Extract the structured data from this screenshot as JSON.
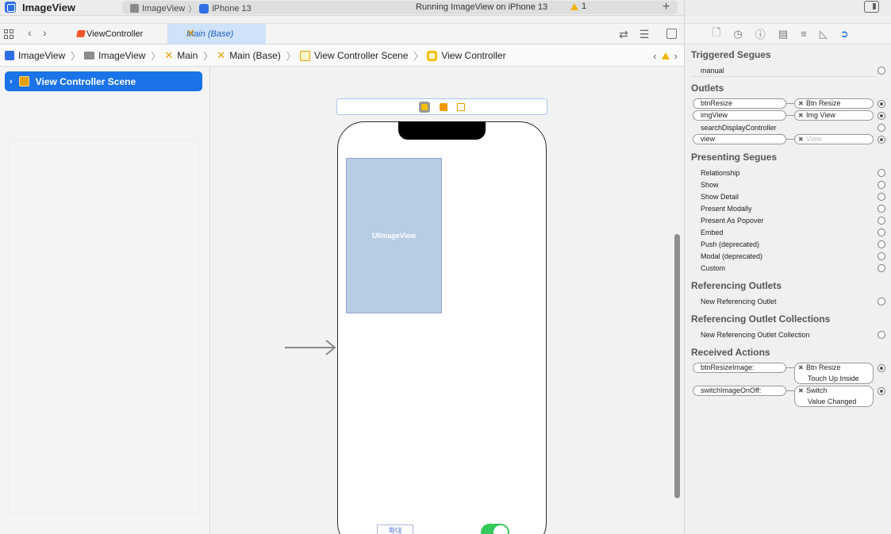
{
  "titlebar": {
    "app_title": "ImageView",
    "target": "ImageView",
    "device": "iPhone 13",
    "run_status": "Running ImageView on iPhone 13",
    "warning_count": "1",
    "add_label": "+"
  },
  "tabs": [
    {
      "label": "ViewController"
    },
    {
      "label": "Main (Base)"
    }
  ],
  "breadcrumb": [
    "ImageView",
    "ImageView",
    "Main",
    "Main (Base)",
    "View Controller Scene",
    "View Controller"
  ],
  "outline": {
    "scene_label": "View Controller Scene"
  },
  "canvas": {
    "image_view_label": "UIImageView",
    "button_label": "확대"
  },
  "inspector": {
    "triggered_segues": {
      "title": "Triggered Segues",
      "items": [
        "manual"
      ]
    },
    "outlets": {
      "title": "Outlets",
      "items": [
        {
          "name": "btnResize",
          "target": "Btn Resize"
        },
        {
          "name": "imgView",
          "target": "Img View"
        },
        {
          "name": "searchDisplayController",
          "target": ""
        },
        {
          "name": "view",
          "target": "View"
        }
      ]
    },
    "presenting_segues": {
      "title": "Presenting Segues",
      "items": [
        "Relationship",
        "Show",
        "Show Detail",
        "Present Modally",
        "Present As Popover",
        "Embed",
        "Push (deprecated)",
        "Modal (deprecated)",
        "Custom"
      ]
    },
    "referencing_outlets": {
      "title": "Referencing Outlets",
      "items": [
        "New Referencing Outlet"
      ]
    },
    "referencing_outlet_collections": {
      "title": "Referencing Outlet Collections",
      "items": [
        "New Referencing Outlet Collection"
      ]
    },
    "received_actions": {
      "title": "Received Actions",
      "items": [
        {
          "name": "btnResizeImage:",
          "target": "Btn Resize",
          "event": "Touch Up Inside"
        },
        {
          "name": "switchImageOnOff:",
          "target": "Switch",
          "event": "Value Changed"
        }
      ]
    }
  }
}
